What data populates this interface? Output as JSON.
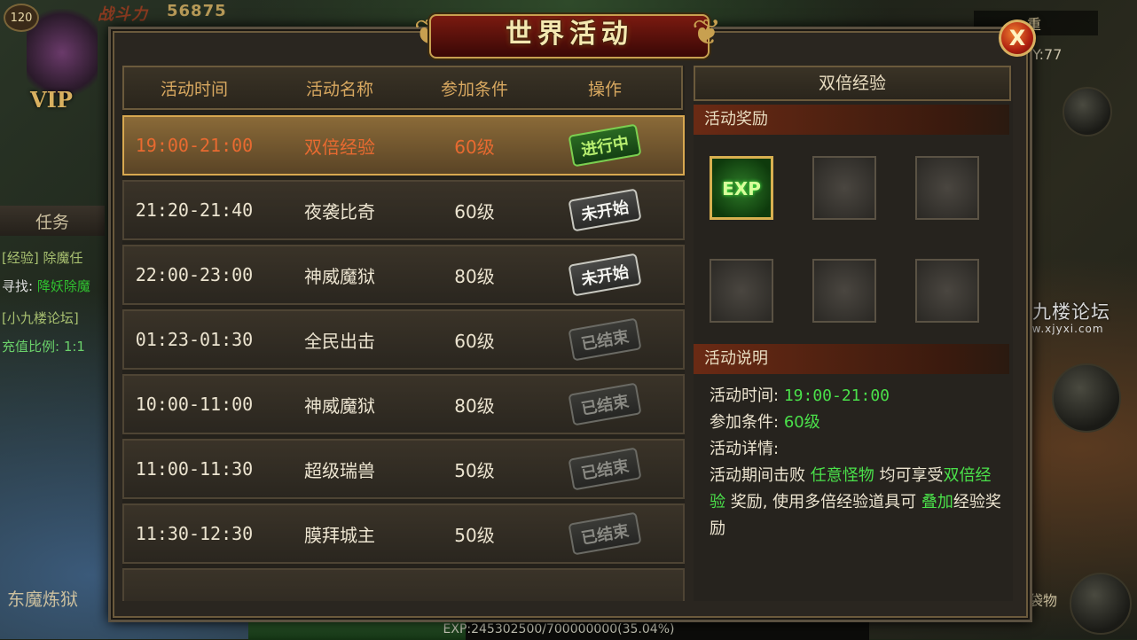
{
  "hud": {
    "level": "120",
    "power_label": "战斗力",
    "power_value": "56875",
    "vip": "VIP",
    "task_tab": "任务",
    "task_line1": "[经验] 除魔任",
    "task_line2_prefix": "寻找: ",
    "task_line2_target": "降妖除魔",
    "task_line3": "[小九楼论坛]",
    "task_line4": "充值比例: 1:1",
    "bottom_left": "东魔炼狱",
    "map_name": "重",
    "map_coord": "Y:77",
    "side_label": "袋物",
    "exp_text": "EXP:245302500/700000000(35.04%)",
    "exp_progress": 0.3504
  },
  "watermark": {
    "title": "小九楼论坛",
    "url": "www.xjyxi.com"
  },
  "dialog": {
    "title": "世界活动",
    "close_label": "X",
    "columns": [
      "活动时间",
      "活动名称",
      "参加条件",
      "操作"
    ],
    "rows": [
      {
        "time": "19:00-21:00",
        "name": "双倍经验",
        "level": "60级",
        "status": "进行中",
        "state": "active",
        "selected": true
      },
      {
        "time": "21:20-21:40",
        "name": "夜袭比奇",
        "level": "60级",
        "status": "未开始",
        "state": "pending"
      },
      {
        "time": "22:00-23:00",
        "name": "神威魔狱",
        "level": "80级",
        "status": "未开始",
        "state": "pending"
      },
      {
        "time": "01:23-01:30",
        "name": "全民出击",
        "level": "60级",
        "status": "已结束",
        "state": "ended"
      },
      {
        "time": "10:00-11:00",
        "name": "神威魔狱",
        "level": "80级",
        "status": "已结束",
        "state": "ended"
      },
      {
        "time": "11:00-11:30",
        "name": "超级瑞兽",
        "level": "50级",
        "status": "已结束",
        "state": "ended"
      },
      {
        "time": "11:30-12:30",
        "name": "膜拜城主",
        "level": "50级",
        "status": "已结束",
        "state": "ended"
      },
      {
        "time": "",
        "name": "",
        "level": "",
        "status": "",
        "state": "ended"
      }
    ],
    "detail": {
      "title": "双倍经验",
      "reward_heading": "活动奖励",
      "reward_item": "EXP",
      "info_heading": "活动说明",
      "time_label": "活动时间:",
      "time_value": "19:00-21:00",
      "cond_label": "参加条件:",
      "cond_value": "60级",
      "detail_label": "活动详情:",
      "desc_1": "活动期间击败 ",
      "desc_hl1": "任意怪物",
      "desc_2": " 均可享受",
      "desc_hl2": "双倍经验",
      "desc_3": " 奖励, 使用多倍经验道具可 ",
      "desc_hl3": "叠加",
      "desc_4": "经验奖励"
    }
  }
}
